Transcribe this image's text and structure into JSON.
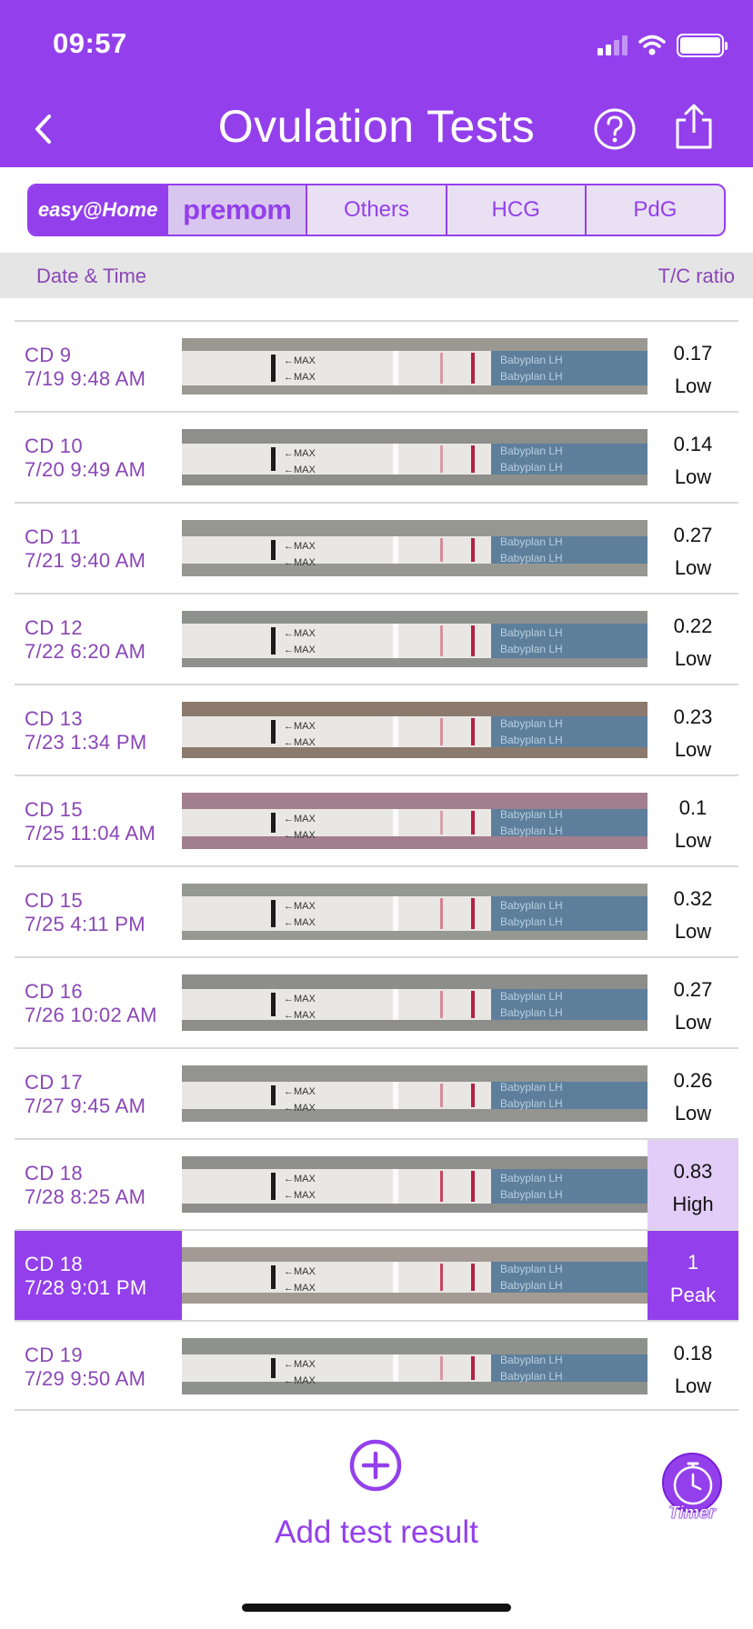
{
  "status_bar": {
    "time": "09:57"
  },
  "header": {
    "title": "Ovulation Tests"
  },
  "brand_tabs": [
    {
      "label": "easy@Home"
    },
    {
      "label": "premom"
    },
    {
      "label": "Others"
    },
    {
      "label": "HCG"
    },
    {
      "label": "PdG"
    }
  ],
  "columns": {
    "date": "Date & Time",
    "ratio": "T/C ratio"
  },
  "tests": [
    {
      "cd": "CD 9",
      "datetime": "7/19 9:48 AM",
      "ratio": "0.17",
      "level": "Low"
    },
    {
      "cd": "CD 10",
      "datetime": "7/20 9:49 AM",
      "ratio": "0.14",
      "level": "Low"
    },
    {
      "cd": "CD 11",
      "datetime": "7/21 9:40 AM",
      "ratio": "0.27",
      "level": "Low"
    },
    {
      "cd": "CD 12",
      "datetime": "7/22 6:20 AM",
      "ratio": "0.22",
      "level": "Low"
    },
    {
      "cd": "CD 13",
      "datetime": "7/23 1:34 PM",
      "ratio": "0.23",
      "level": "Low"
    },
    {
      "cd": "CD 15",
      "datetime": "7/25 11:04 AM",
      "ratio": "0.1",
      "level": "Low"
    },
    {
      "cd": "CD 15",
      "datetime": "7/25 4:11 PM",
      "ratio": "0.32",
      "level": "Low"
    },
    {
      "cd": "CD 16",
      "datetime": "7/26 10:02 AM",
      "ratio": "0.27",
      "level": "Low"
    },
    {
      "cd": "CD 17",
      "datetime": "7/27 9:45 AM",
      "ratio": "0.26",
      "level": "Low"
    },
    {
      "cd": "CD 18",
      "datetime": "7/28 8:25 AM",
      "ratio": "0.83",
      "level": "High"
    },
    {
      "cd": "CD 18",
      "datetime": "7/28 9:01 PM",
      "ratio": "1",
      "level": "Peak"
    },
    {
      "cd": "CD 19",
      "datetime": "7/29 9:50 AM",
      "ratio": "0.18",
      "level": "Low"
    }
  ],
  "strip_text": {
    "max_mark": "←MAX",
    "brand": "Babyplan LH"
  },
  "footer": {
    "add_label": "Add test result",
    "timer_label": "Timer"
  },
  "colors": {
    "primary": "#9340ec",
    "text_purple": "#8a47b6",
    "high_bg": "#e1cdf7",
    "peak_bg": "#9340ec"
  },
  "icons": [
    "back-chevron-icon",
    "help-icon",
    "share-icon",
    "add-circle-icon",
    "stopwatch-icon"
  ]
}
